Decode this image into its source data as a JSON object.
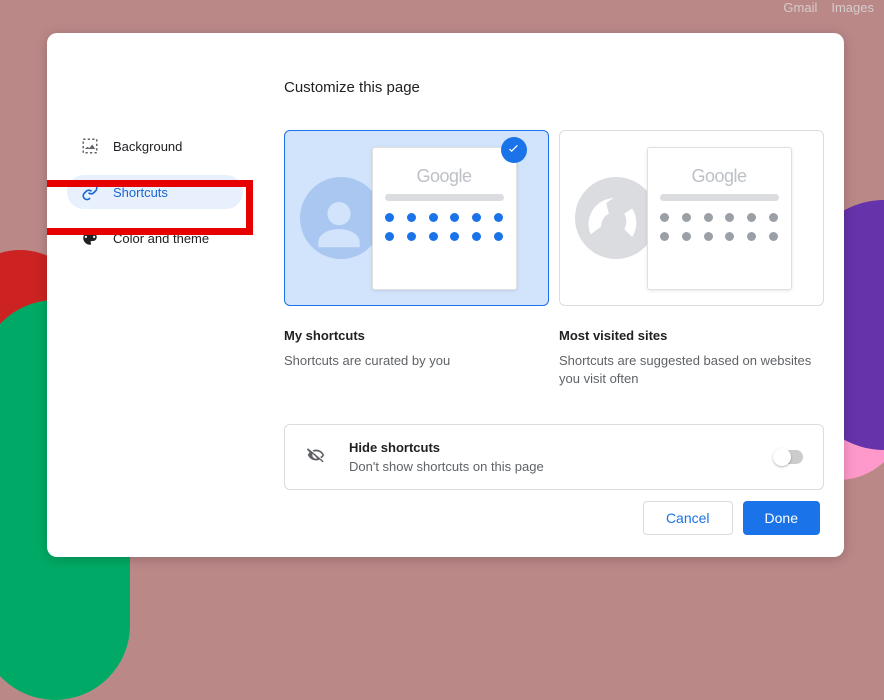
{
  "top_links": {
    "gmail": "Gmail",
    "images": "Images"
  },
  "dialog": {
    "title": "Customize this page",
    "sidebar": {
      "background": "Background",
      "shortcuts": "Shortcuts",
      "color_theme": "Color and theme"
    },
    "cards": {
      "preview_brand": "Google",
      "my_shortcuts": {
        "title": "My shortcuts",
        "desc": "Shortcuts are curated by you"
      },
      "most_visited": {
        "title": "Most visited sites",
        "desc": "Shortcuts are suggested based on websites you visit often"
      }
    },
    "hide": {
      "title": "Hide shortcuts",
      "desc": "Don't show shortcuts on this page"
    },
    "footer": {
      "cancel": "Cancel",
      "done": "Done"
    }
  }
}
